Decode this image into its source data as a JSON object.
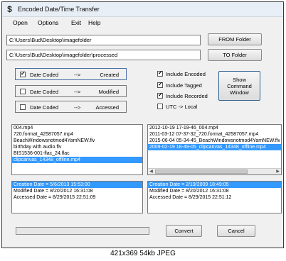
{
  "window": {
    "title": "Encoded Date/Time Transfer"
  },
  "menu": [
    "Open",
    "Options",
    "Exit",
    "Help"
  ],
  "paths": {
    "from_value": "C:\\Users\\Bud\\Desktop\\imagefolder",
    "to_value": "C:\\Users\\Bud\\Desktop\\imagefolder\\processed"
  },
  "buttons": {
    "from_folder": "FROM Folder",
    "to_folder": "TO Folder",
    "show_command_window": "Show Command Window",
    "convert": "Convert",
    "cancel": "Cancel"
  },
  "mappings": [
    {
      "label": "Date Coded",
      "arrow": "-->",
      "target": "Created",
      "checked": true
    },
    {
      "label": "Date Coded",
      "arrow": "-->",
      "target": "Modified",
      "checked": false
    },
    {
      "label": "Date Coded",
      "arrow": "-->",
      "target": "Accessed",
      "checked": false
    }
  ],
  "options": [
    {
      "label": "Include Encoded",
      "checked": true
    },
    {
      "label": "Include Tagged",
      "checked": true
    },
    {
      "label": "Include Recorded",
      "checked": true
    },
    {
      "label": "UTC -> Local",
      "checked": false
    }
  ],
  "source_files": [
    "004.mp4",
    "720.format_42587057.mp4",
    "BeachWindowsnotmod4YamNEW.flv",
    "birthday with audio.flv",
    "BIS1536-001-flac_24.flac",
    "clipcanvas_14348_offline.mp4"
  ],
  "source_selected_index": 5,
  "dest_files": [
    "2012-10-19 17-19-46_004.mp4",
    "2011-03-12 07-37-32_720.format_42587057.mp4",
    "2015-06-04 05-34-45_BeachWindowsnotmod4YamNEW.flv",
    "2009-02-19 18-49-05_clipcanvas_14348_offline.mp4"
  ],
  "dest_selected_index": 3,
  "source_details": [
    "Creation Date = 5/6/2013 15:53:00",
    "Modified Date = 8/20/2012 16:31:08",
    "Accessed Date = 8/29/2015 22:51:09"
  ],
  "dest_details": [
    "Creation Date = 2/19/2009 18:49:05",
    "Modified Date = 8/20/2012 16:31:08",
    "Accessed Date = 8/29/2015 22:51:12"
  ],
  "progress": 0,
  "caption": "421x369 54kb JPEG"
}
